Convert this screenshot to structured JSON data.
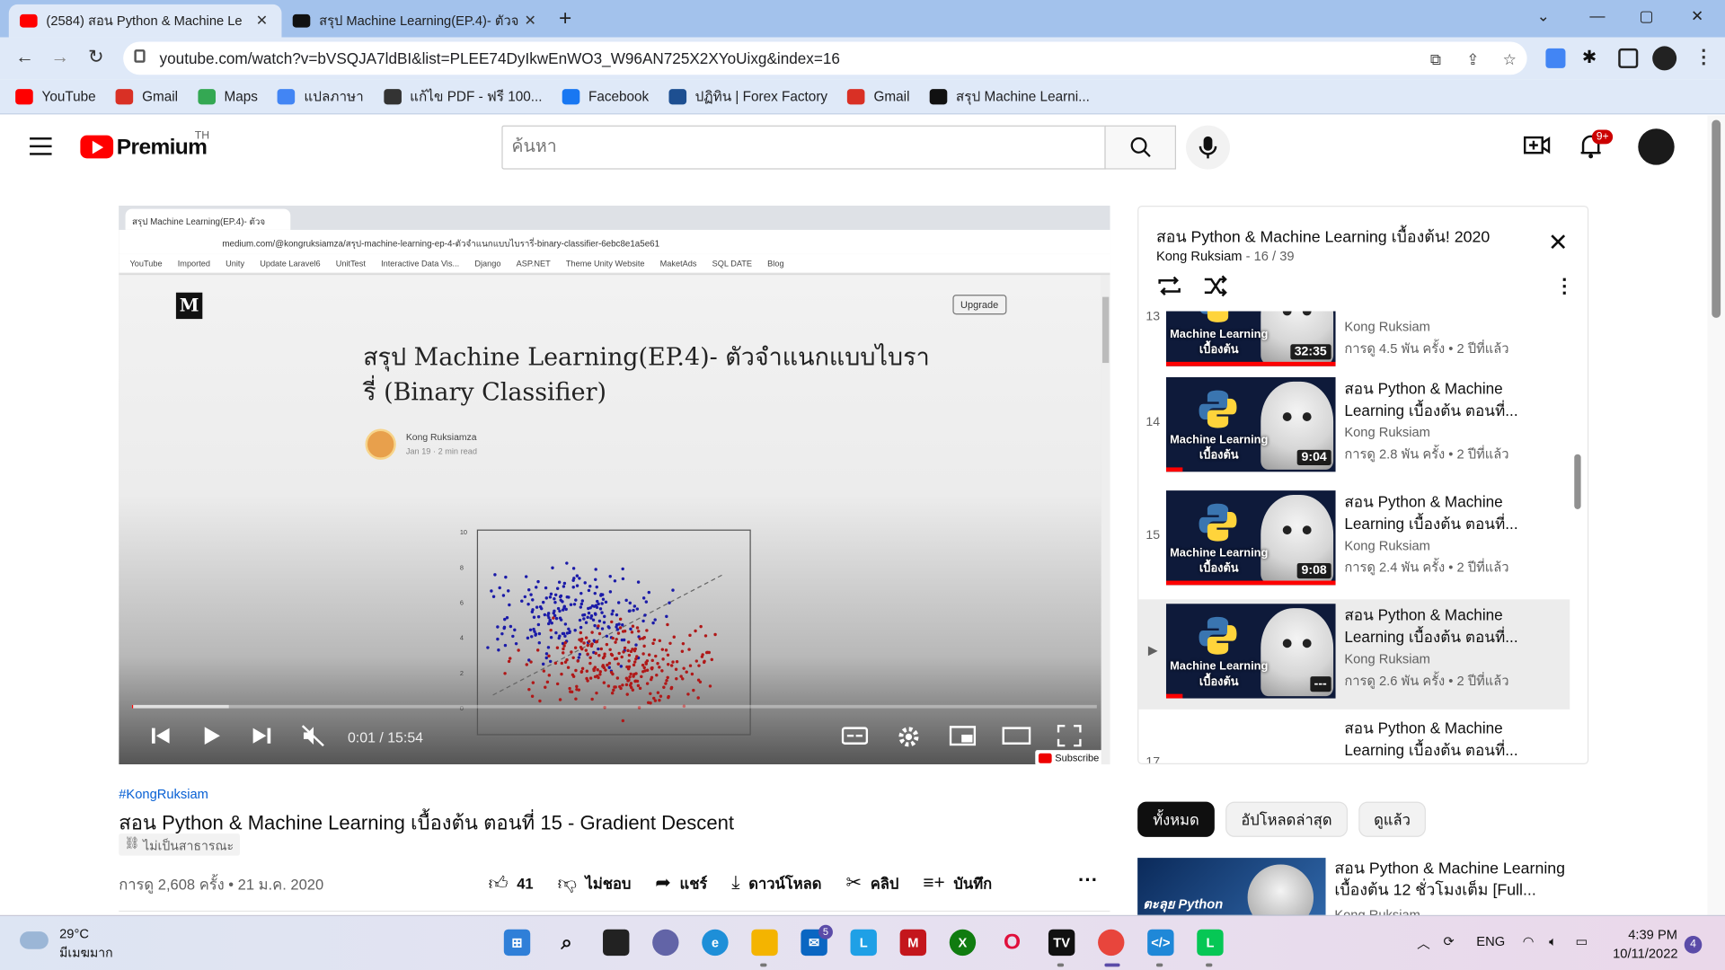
{
  "browser": {
    "tabs": [
      {
        "title": "(2584) สอน Python & Machine Le",
        "active": true,
        "favicon": "youtube-favicon",
        "color": "#ff0000"
      },
      {
        "title": "สรุป Machine Learning(EP.4)- ตัวจ",
        "active": false,
        "favicon": "medium-favicon",
        "color": "#111111"
      }
    ],
    "url": "youtube.com/watch?v=bVSQJA7ldBI&list=PLEE74DyIkwEnWO3_W96AN725X2XYoUixg&index=16",
    "bookmarks": [
      {
        "label": "YouTube",
        "icon": "youtube-icon",
        "color": "#ff0000"
      },
      {
        "label": "Gmail",
        "icon": "gmail-icon",
        "color": "#d93025"
      },
      {
        "label": "Maps",
        "icon": "maps-icon",
        "color": "#34a853"
      },
      {
        "label": "แปลภาษา",
        "icon": "translate-icon",
        "color": "#4285f4"
      },
      {
        "label": "แก้ไข PDF - ฟรี 100...",
        "icon": "pdf-icon",
        "color": "#333333"
      },
      {
        "label": "Facebook",
        "icon": "facebook-icon",
        "color": "#1877f2"
      },
      {
        "label": "ปฏิทิน | Forex Factory",
        "icon": "forex-icon",
        "color": "#1d4f91"
      },
      {
        "label": "Gmail",
        "icon": "gmail-icon",
        "color": "#d93025"
      },
      {
        "label": "สรุป Machine Learni...",
        "icon": "medium-icon",
        "color": "#111111"
      }
    ]
  },
  "header": {
    "brand": "Premium",
    "region": "TH",
    "search_placeholder": "ค้นหา",
    "notification_badge": "9+"
  },
  "player": {
    "embedded": {
      "tab_title": "สรุป Machine Learning(EP.4)- ตัวจ",
      "url": "medium.com/@kongruksiamza/สรุป-machine-learning-ep-4-ตัวจำแนกแบบไบรารี่-binary-classifier-6ebc8e1a5e61",
      "bookmarks": [
        "YouTube",
        "Imported",
        "Unity",
        "Update Laravel6",
        "UnitTest",
        "Interactive Data Vis...",
        "Django",
        "ASP.NET",
        "Theme Unity Website",
        "MaketAds",
        "SQL DATE",
        "Blog"
      ],
      "upgrade": "Upgrade",
      "article_title": "สรุป Machine Learning(EP.4)- ตัวจำแนกแบบไบรารี่ (Binary Classifier)",
      "author": "Kong Ruksiamza",
      "author_meta": "Jan 19 · 2 min read",
      "plot_y_ticks": [
        "10",
        "8",
        "6",
        "4",
        "2",
        "0"
      ],
      "subscribe": "Subscribe"
    },
    "time": "0:01 / 15:54",
    "progress": 0.001,
    "buffered": 0.1
  },
  "video": {
    "hashtag": "#KongRuksiam",
    "title": "สอน Python & Machine Learning เบื้องต้น ตอนที่ 15 - Gradient Descent",
    "visibility": "ไม่เป็นสาธารณะ",
    "views": "การดู 2,608 ครั้ง • 21 ม.ค. 2020",
    "actions": {
      "likes": "41",
      "dislike": "ไม่ชอบ",
      "share": "แชร์",
      "download": "ดาวน์โหลด",
      "clip": "คลิป",
      "save": "บันทึก"
    }
  },
  "playlist": {
    "title": "สอน Python & Machine Learning เบื้องต้น! 2020",
    "channel": "Kong Ruksiam",
    "position": "16 / 39",
    "items": [
      {
        "index": "13",
        "title": "",
        "channel": "Kong Ruksiam",
        "views": "การดู 4.5 พัน ครั้ง • 2 ปีที่แล้ว",
        "duration": "32:35",
        "thumb_text": "Machine Learning เบื้องต้น",
        "watched": 1.0
      },
      {
        "index": "14",
        "title": "สอน Python & Machine Learning เบื้องต้น ตอนที่...",
        "channel": "Kong Ruksiam",
        "views": "การดู 2.8 พัน ครั้ง • 2 ปีที่แล้ว",
        "duration": "9:04",
        "thumb_text": "Machine Learning เบื้องต้น",
        "watched": 0.1
      },
      {
        "index": "15",
        "title": "สอน Python & Machine Learning เบื้องต้น ตอนที่...",
        "channel": "Kong Ruksiam",
        "views": "การดู 2.4 พัน ครั้ง • 2 ปีที่แล้ว",
        "duration": "9:08",
        "thumb_text": "Machine Learning เบื้องต้น",
        "watched": 1.0
      },
      {
        "index": "▶",
        "title": "สอน Python & Machine Learning เบื้องต้น ตอนที่...",
        "channel": "Kong Ruksiam",
        "views": "การดู 2.6 พัน ครั้ง • 2 ปีที่แล้ว",
        "duration": "---",
        "thumb_text": "Machine Learning เบื้องต้น",
        "watched": 0.1
      },
      {
        "index": "17",
        "title": "สอน Python & Machine Learning เบื้องต้น ตอนที่...",
        "channel": "",
        "views": "",
        "duration": "",
        "thumb_text": "",
        "watched": 0
      }
    ]
  },
  "chips": [
    "ทั้งหมด",
    "อัปโหลดล่าสุด",
    "ดูแล้ว"
  ],
  "recommendation": {
    "title": "สอน Python & Machine Learning เบื้องต้น 12 ชั่วโมงเต็ม [Full...",
    "channel": "Kong Ruksiam",
    "thumb_text": "ตะลุย Python"
  },
  "taskbar": {
    "temperature": "29°C",
    "condition": "มีเมฆมาก",
    "mail_badge": "5",
    "language": "ENG",
    "time": "4:39 PM",
    "date": "10/11/2022",
    "notifications": "4"
  }
}
